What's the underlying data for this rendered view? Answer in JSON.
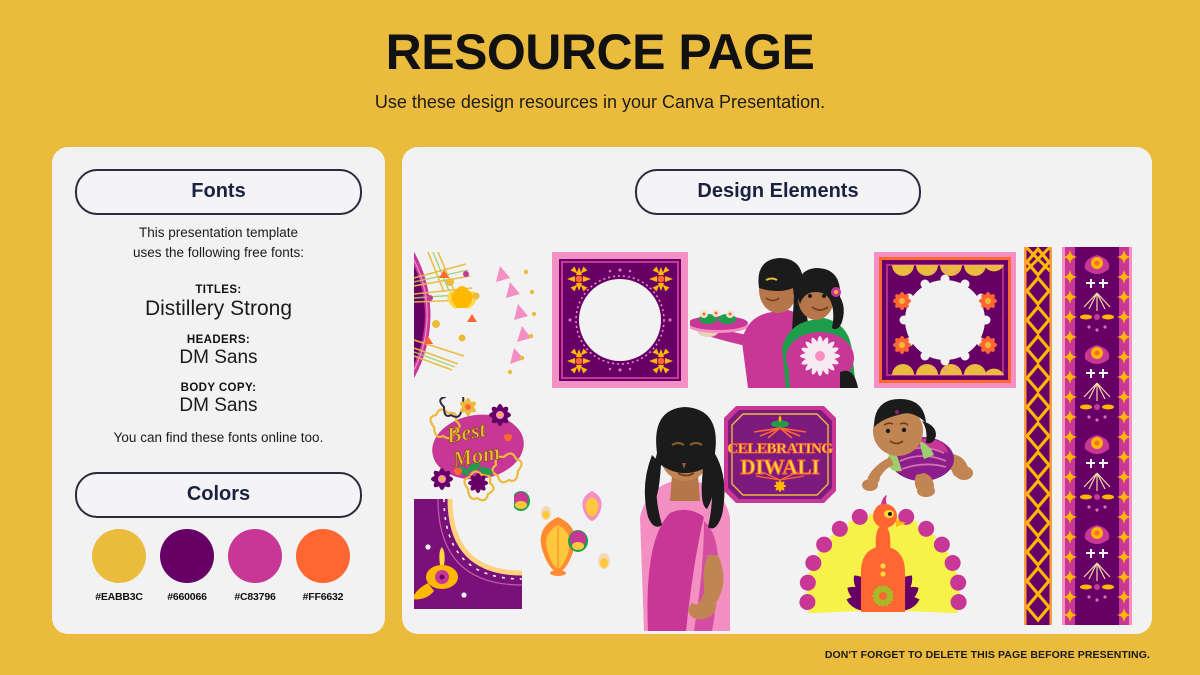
{
  "header": {
    "title": "RESOURCE PAGE",
    "subtitle": "Use these design resources in your Canva Presentation."
  },
  "fonts_panel": {
    "pill_label": "Fonts",
    "intro": "This presentation template\nuses the following free fonts:",
    "groups": [
      {
        "label": "TITLES:",
        "value": "Distillery Strong"
      },
      {
        "label": "HEADERS:",
        "value": "DM Sans"
      },
      {
        "label": "BODY COPY:",
        "value": "DM Sans"
      }
    ],
    "outro": "You can find these fonts online too."
  },
  "colors_panel": {
    "pill_label": "Colors",
    "swatches": [
      {
        "hex": "#EABB3C"
      },
      {
        "hex": "#660066"
      },
      {
        "hex": "#C83796"
      },
      {
        "hex": "#FF6632"
      }
    ]
  },
  "design_panel": {
    "pill_label": "Design Elements",
    "elements": [
      {
        "name": "mandala-quarter-circle-ornament"
      },
      {
        "name": "square-circle-photo-frame-pink"
      },
      {
        "name": "two-women-with-sweets-illustration"
      },
      {
        "name": "square-circle-photo-frame-purple"
      },
      {
        "name": "zigzag-vertical-border-strip"
      },
      {
        "name": "floral-vertical-border-strip"
      },
      {
        "name": "best-mom-floral-sticker"
      },
      {
        "name": "woman-in-pink-saree-illustration"
      },
      {
        "name": "celebrating-diwali-badge"
      },
      {
        "name": "crawling-baby-illustration"
      },
      {
        "name": "diya-corner-ornament"
      },
      {
        "name": "floating-sky-lanterns"
      },
      {
        "name": "peacock-illustration"
      }
    ],
    "sticker_text": {
      "line1": "Best",
      "line2": "Mom"
    },
    "badge_text": {
      "line1": "CELEBRATING",
      "line2": "DIWALI"
    }
  },
  "footer": {
    "note": "DON'T FORGET TO DELETE THIS PAGE BEFORE PRESENTING."
  },
  "theme": {
    "background": "#EABB3C",
    "panel_bg": "#F2F2F2",
    "pill_border": "#2b2b3d",
    "text_dark": "#111111",
    "purple_deep": "#660066",
    "purple_mid": "#7D1A7D",
    "magenta": "#C83796",
    "pink_light": "#F48FC4",
    "orange": "#FF6632",
    "yellow": "#EABB3C",
    "yellow_bright": "#FFD93D",
    "green": "#1E9E4A"
  }
}
